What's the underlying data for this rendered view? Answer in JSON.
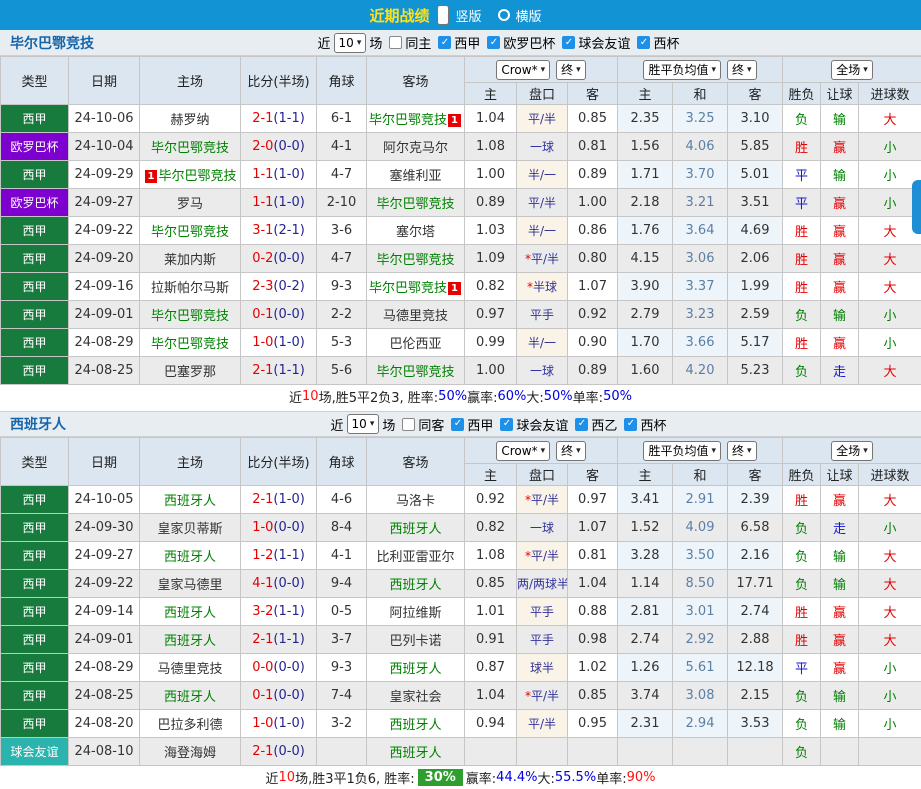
{
  "topbar": {
    "title": "近期战绩",
    "vertical": "竖版",
    "horizontal": "横版"
  },
  "colors": {
    "accent_blue": "#1193D4",
    "title_yellow": "#FFE11A",
    "section_title_blue": "#1566A9",
    "league_green": "#177B3E",
    "league_purple": "#7D00CF",
    "league_teal": "#2BB3AD",
    "team_green": "#008000",
    "score_red": "#E60000",
    "half_navy": "#24248F",
    "win_red": "#E60000",
    "draw_blue": "#1515CC",
    "lose_green": "#008000",
    "summary_badge_green": "#2E9E2E",
    "checkbox_blue": "#1E90E8"
  },
  "columns": {
    "type": "类型",
    "date": "日期",
    "home": "主场",
    "score": "比分(半场)",
    "corner": "角球",
    "away": "客场",
    "odds_home": "主",
    "handicap": "盘口",
    "odds_away": "客",
    "avg_home": "主",
    "avg_draw": "和",
    "avg_away": "客",
    "result": "胜负",
    "rang": "让球",
    "goals": "进球数"
  },
  "sections": [
    {
      "team": "毕尔巴鄂竞技",
      "filters": {
        "near": "近",
        "count": "10",
        "games": "场",
        "same": {
          "label": "同主",
          "checked": false
        },
        "leagues": [
          {
            "label": "西甲",
            "checked": true
          },
          {
            "label": "欧罗巴杯",
            "checked": true
          },
          {
            "label": "球会友谊",
            "checked": true
          },
          {
            "label": "西杯",
            "checked": true
          }
        ]
      },
      "controls": {
        "company": "Crow*",
        "company_time": "终",
        "avg": "胜平负均值",
        "avg_time": "终",
        "scope": "全场"
      },
      "rows": [
        {
          "type": "西甲",
          "tc": "green",
          "date": "24-10-06",
          "home": "赫罗纳",
          "hg": false,
          "score": "2-1",
          "half": "(1-1)",
          "corner": "6-1",
          "away": "毕尔巴鄂竞技",
          "ag": true,
          "ab": "1",
          "o1": "1.04",
          "pan": "平/半",
          "star": false,
          "o2": "0.85",
          "a1": "2.35",
          "a2": "3.25",
          "a3": "3.10",
          "res": "负",
          "resC": "green",
          "rang": "输",
          "rangC": "green",
          "goal": "大",
          "goalC": "red"
        },
        {
          "type": "欧罗巴杯",
          "tc": "purple",
          "date": "24-10-04",
          "home": "毕尔巴鄂竞技",
          "hg": true,
          "score": "2-0",
          "half": "(0-0)",
          "corner": "4-1",
          "away": "阿尔克马尔",
          "ag": false,
          "o1": "1.08",
          "pan": "一球",
          "star": false,
          "o2": "0.81",
          "a1": "1.56",
          "a2": "4.06",
          "a3": "5.85",
          "res": "胜",
          "resC": "red",
          "rang": "赢",
          "rangC": "red",
          "goal": "小",
          "goalC": "green"
        },
        {
          "type": "西甲",
          "tc": "green",
          "date": "24-09-29",
          "home": "毕尔巴鄂竞技",
          "hg": true,
          "hb": "1",
          "hbPre": true,
          "score": "1-1",
          "half": "(1-0)",
          "corner": "4-7",
          "away": "塞维利亚",
          "ag": false,
          "o1": "1.00",
          "pan": "半/一",
          "star": false,
          "o2": "0.89",
          "a1": "1.71",
          "a2": "3.70",
          "a3": "5.01",
          "res": "平",
          "resC": "blue",
          "rang": "输",
          "rangC": "green",
          "goal": "小",
          "goalC": "green"
        },
        {
          "type": "欧罗巴杯",
          "tc": "purple",
          "date": "24-09-27",
          "home": "罗马",
          "hg": false,
          "score": "1-1",
          "half": "(1-0)",
          "corner": "2-10",
          "away": "毕尔巴鄂竞技",
          "ag": true,
          "o1": "0.89",
          "pan": "平/半",
          "star": false,
          "o2": "1.00",
          "a1": "2.18",
          "a2": "3.21",
          "a3": "3.51",
          "res": "平",
          "resC": "blue",
          "rang": "赢",
          "rangC": "red",
          "goal": "小",
          "goalC": "green"
        },
        {
          "type": "西甲",
          "tc": "green",
          "date": "24-09-22",
          "home": "毕尔巴鄂竞技",
          "hg": true,
          "score": "3-1",
          "half": "(2-1)",
          "corner": "3-6",
          "away": "塞尔塔",
          "ag": false,
          "o1": "1.03",
          "pan": "半/一",
          "star": false,
          "o2": "0.86",
          "a1": "1.76",
          "a2": "3.64",
          "a3": "4.69",
          "res": "胜",
          "resC": "red",
          "rang": "赢",
          "rangC": "red",
          "goal": "大",
          "goalC": "red"
        },
        {
          "type": "西甲",
          "tc": "green",
          "date": "24-09-20",
          "home": "莱加内斯",
          "hg": false,
          "score": "0-2",
          "half": "(0-0)",
          "corner": "4-7",
          "away": "毕尔巴鄂竞技",
          "ag": true,
          "o1": "1.09",
          "pan": "平/半",
          "star": true,
          "o2": "0.80",
          "a1": "4.15",
          "a2": "3.06",
          "a3": "2.06",
          "res": "胜",
          "resC": "red",
          "rang": "赢",
          "rangC": "red",
          "goal": "大",
          "goalC": "red"
        },
        {
          "type": "西甲",
          "tc": "green",
          "date": "24-09-16",
          "home": "拉斯帕尔马斯",
          "hg": false,
          "score": "2-3",
          "half": "(0-2)",
          "corner": "9-3",
          "away": "毕尔巴鄂竞技",
          "ag": true,
          "ab": "1",
          "o1": "0.82",
          "pan": "半球",
          "star": true,
          "o2": "1.07",
          "a1": "3.90",
          "a2": "3.37",
          "a3": "1.99",
          "res": "胜",
          "resC": "red",
          "rang": "赢",
          "rangC": "red",
          "goal": "大",
          "goalC": "red"
        },
        {
          "type": "西甲",
          "tc": "green",
          "date": "24-09-01",
          "home": "毕尔巴鄂竞技",
          "hg": true,
          "score": "0-1",
          "half": "(0-0)",
          "corner": "2-2",
          "away": "马德里竞技",
          "ag": false,
          "o1": "0.97",
          "pan": "平手",
          "star": false,
          "o2": "0.92",
          "a1": "2.79",
          "a2": "3.23",
          "a3": "2.59",
          "res": "负",
          "resC": "green",
          "rang": "输",
          "rangC": "green",
          "goal": "小",
          "goalC": "green"
        },
        {
          "type": "西甲",
          "tc": "green",
          "date": "24-08-29",
          "home": "毕尔巴鄂竞技",
          "hg": true,
          "score": "1-0",
          "half": "(1-0)",
          "corner": "5-3",
          "away": "巴伦西亚",
          "ag": false,
          "o1": "0.99",
          "pan": "半/一",
          "star": false,
          "o2": "0.90",
          "a1": "1.70",
          "a2": "3.66",
          "a3": "5.17",
          "res": "胜",
          "resC": "red",
          "rang": "赢",
          "rangC": "red",
          "goal": "小",
          "goalC": "green"
        },
        {
          "type": "西甲",
          "tc": "green",
          "date": "24-08-25",
          "home": "巴塞罗那",
          "hg": false,
          "score": "2-1",
          "half": "(1-1)",
          "corner": "5-6",
          "away": "毕尔巴鄂竞技",
          "ag": true,
          "o1": "1.00",
          "pan": "一球",
          "star": false,
          "o2": "0.89",
          "a1": "1.60",
          "a2": "4.20",
          "a3": "5.23",
          "res": "负",
          "resC": "green",
          "rang": "走",
          "rangC": "blue",
          "goal": "大",
          "goalC": "red"
        }
      ],
      "summary": {
        "parts": [
          {
            "t": "近",
            "c": "black"
          },
          {
            "t": "10",
            "c": "red"
          },
          {
            "t": "场,胜5平2负3, 胜率:",
            "c": "black"
          },
          {
            "t": "50%",
            "c": "blue"
          },
          {
            "t": " 赢率:",
            "c": "black"
          },
          {
            "t": "60%",
            "c": "blue"
          },
          {
            "t": " 大:",
            "c": "black"
          },
          {
            "t": "50%",
            "c": "blue"
          },
          {
            "t": " 单率:",
            "c": "black"
          },
          {
            "t": "50%",
            "c": "blue"
          }
        ]
      }
    },
    {
      "team": "西班牙人",
      "filters": {
        "near": "近",
        "count": "10",
        "games": "场",
        "same": {
          "label": "同客",
          "checked": false
        },
        "leagues": [
          {
            "label": "西甲",
            "checked": true
          },
          {
            "label": "球会友谊",
            "checked": true
          },
          {
            "label": "西乙",
            "checked": true
          },
          {
            "label": "西杯",
            "checked": true
          }
        ]
      },
      "controls": {
        "company": "Crow*",
        "company_time": "终",
        "avg": "胜平负均值",
        "avg_time": "终",
        "scope": "全场"
      },
      "rows": [
        {
          "type": "西甲",
          "tc": "green",
          "date": "24-10-05",
          "home": "西班牙人",
          "hg": true,
          "score": "2-1",
          "half": "(1-0)",
          "corner": "4-6",
          "away": "马洛卡",
          "ag": false,
          "o1": "0.92",
          "pan": "平/半",
          "star": true,
          "o2": "0.97",
          "a1": "3.41",
          "a2": "2.91",
          "a3": "2.39",
          "res": "胜",
          "resC": "red",
          "rang": "赢",
          "rangC": "red",
          "goal": "大",
          "goalC": "red"
        },
        {
          "type": "西甲",
          "tc": "green",
          "date": "24-09-30",
          "home": "皇家贝蒂斯",
          "hg": false,
          "score": "1-0",
          "half": "(0-0)",
          "corner": "8-4",
          "away": "西班牙人",
          "ag": true,
          "o1": "0.82",
          "pan": "一球",
          "star": false,
          "o2": "1.07",
          "a1": "1.52",
          "a2": "4.09",
          "a3": "6.58",
          "res": "负",
          "resC": "green",
          "rang": "走",
          "rangC": "blue",
          "goal": "小",
          "goalC": "green"
        },
        {
          "type": "西甲",
          "tc": "green",
          "date": "24-09-27",
          "home": "西班牙人",
          "hg": true,
          "score": "1-2",
          "half": "(1-1)",
          "corner": "4-1",
          "away": "比利亚雷亚尔",
          "ag": false,
          "o1": "1.08",
          "pan": "平/半",
          "star": true,
          "o2": "0.81",
          "a1": "3.28",
          "a2": "3.50",
          "a3": "2.16",
          "res": "负",
          "resC": "green",
          "rang": "输",
          "rangC": "green",
          "goal": "大",
          "goalC": "red"
        },
        {
          "type": "西甲",
          "tc": "green",
          "date": "24-09-22",
          "home": "皇家马德里",
          "hg": false,
          "score": "4-1",
          "half": "(0-0)",
          "corner": "9-4",
          "away": "西班牙人",
          "ag": true,
          "o1": "0.85",
          "pan": "两/两球半",
          "star": false,
          "o2": "1.04",
          "a1": "1.14",
          "a2": "8.50",
          "a3": "17.71",
          "res": "负",
          "resC": "green",
          "rang": "输",
          "rangC": "green",
          "goal": "大",
          "goalC": "red"
        },
        {
          "type": "西甲",
          "tc": "green",
          "date": "24-09-14",
          "home": "西班牙人",
          "hg": true,
          "score": "3-2",
          "half": "(1-1)",
          "corner": "0-5",
          "away": "阿拉维斯",
          "ag": false,
          "o1": "1.01",
          "pan": "平手",
          "star": false,
          "o2": "0.88",
          "a1": "2.81",
          "a2": "3.01",
          "a3": "2.74",
          "res": "胜",
          "resC": "red",
          "rang": "赢",
          "rangC": "red",
          "goal": "大",
          "goalC": "red"
        },
        {
          "type": "西甲",
          "tc": "green",
          "date": "24-09-01",
          "home": "西班牙人",
          "hg": true,
          "score": "2-1",
          "half": "(1-1)",
          "corner": "3-7",
          "away": "巴列卡诺",
          "ag": false,
          "o1": "0.91",
          "pan": "平手",
          "star": false,
          "o2": "0.98",
          "a1": "2.74",
          "a2": "2.92",
          "a3": "2.88",
          "res": "胜",
          "resC": "red",
          "rang": "赢",
          "rangC": "red",
          "goal": "大",
          "goalC": "red"
        },
        {
          "type": "西甲",
          "tc": "green",
          "date": "24-08-29",
          "home": "马德里竞技",
          "hg": false,
          "score": "0-0",
          "half": "(0-0)",
          "corner": "9-3",
          "away": "西班牙人",
          "ag": true,
          "o1": "0.87",
          "pan": "球半",
          "star": false,
          "o2": "1.02",
          "a1": "1.26",
          "a2": "5.61",
          "a3": "12.18",
          "res": "平",
          "resC": "blue",
          "rang": "赢",
          "rangC": "red",
          "goal": "小",
          "goalC": "green"
        },
        {
          "type": "西甲",
          "tc": "green",
          "date": "24-08-25",
          "home": "西班牙人",
          "hg": true,
          "score": "0-1",
          "half": "(0-0)",
          "corner": "7-4",
          "away": "皇家社会",
          "ag": false,
          "o1": "1.04",
          "pan": "平/半",
          "star": true,
          "o2": "0.85",
          "a1": "3.74",
          "a2": "3.08",
          "a3": "2.15",
          "res": "负",
          "resC": "green",
          "rang": "输",
          "rangC": "green",
          "goal": "小",
          "goalC": "green"
        },
        {
          "type": "西甲",
          "tc": "green",
          "date": "24-08-20",
          "home": "巴拉多利德",
          "hg": false,
          "score": "1-0",
          "half": "(1-0)",
          "corner": "3-2",
          "away": "西班牙人",
          "ag": true,
          "o1": "0.94",
          "pan": "平/半",
          "star": false,
          "o2": "0.95",
          "a1": "2.31",
          "a2": "2.94",
          "a3": "3.53",
          "res": "负",
          "resC": "green",
          "rang": "输",
          "rangC": "green",
          "goal": "小",
          "goalC": "green"
        },
        {
          "type": "球会友谊",
          "tc": "teal",
          "date": "24-08-10",
          "home": "海登海姆",
          "hg": false,
          "score": "2-1",
          "half": "(0-0)",
          "corner": "",
          "away": "西班牙人",
          "ag": true,
          "o1": "",
          "pan": "",
          "star": false,
          "o2": "",
          "a1": "",
          "a2": "",
          "a3": "",
          "res": "负",
          "resC": "green",
          "rang": "",
          "rangC": "green",
          "goal": "",
          "goalC": "green"
        }
      ],
      "summary": {
        "parts": [
          {
            "t": "近",
            "c": "black"
          },
          {
            "t": "10",
            "c": "red"
          },
          {
            "t": "场,胜3平1负6, 胜率: ",
            "c": "black"
          },
          {
            "t": "30%",
            "c": "badge"
          },
          {
            "t": " 赢率:",
            "c": "black"
          },
          {
            "t": "44.4%",
            "c": "blue"
          },
          {
            "t": " 大:",
            "c": "black"
          },
          {
            "t": "55.5%",
            "c": "blue"
          },
          {
            "t": " 单率:",
            "c": "black"
          },
          {
            "t": "90%",
            "c": "red"
          }
        ]
      }
    }
  ]
}
